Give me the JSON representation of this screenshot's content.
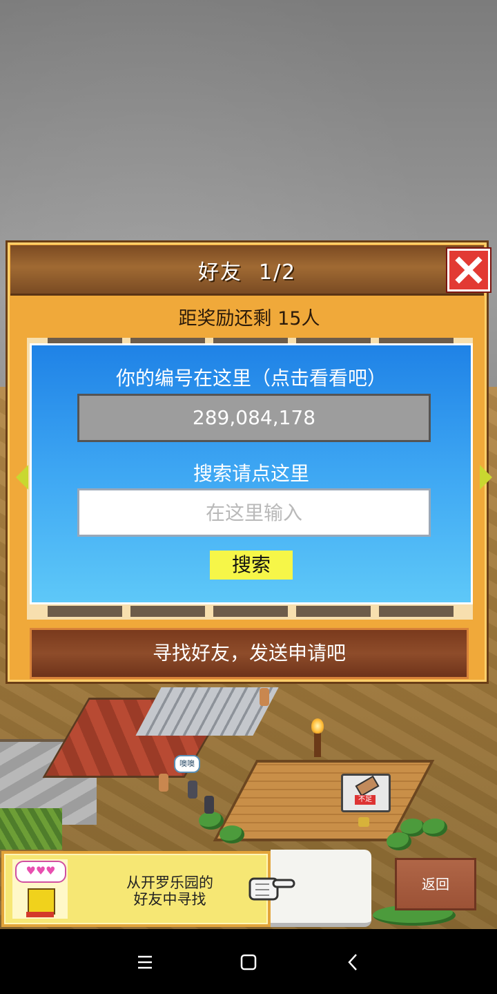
{
  "dialog": {
    "title": "好友",
    "page": "1/2",
    "reward_text": "距奖励还剩 15人",
    "id_label": "你的编号在这里（点击看看吧）",
    "id_value": "289,084,178",
    "search_label": "搜索请点这里",
    "search_placeholder": "在这里输入",
    "search_button": "搜索",
    "find_friends_button": "寻找好友，发送申请吧"
  },
  "promo": {
    "text_line1": "从开罗乐园的",
    "text_line2": "好友中寻找",
    "hearts": "♥♥♥"
  },
  "scene": {
    "speech_bubble": "噢噢",
    "bed_tag": "不足"
  },
  "back_button": "返回",
  "icons": {
    "close": "close-icon",
    "arrow_left": "arrow-left-icon",
    "arrow_right": "arrow-right-icon",
    "hand": "pointing-hand-icon",
    "nav_menu": "menu-icon",
    "nav_home": "home-icon",
    "nav_back": "back-icon"
  },
  "colors": {
    "dialog_bg": "#f0a93a",
    "title_bar": "#8a5629",
    "panel_blue": "#3ea7f3",
    "search_button_bg": "#f6f648",
    "close_red": "#e23a33",
    "find_bar": "#8e4c2a"
  }
}
